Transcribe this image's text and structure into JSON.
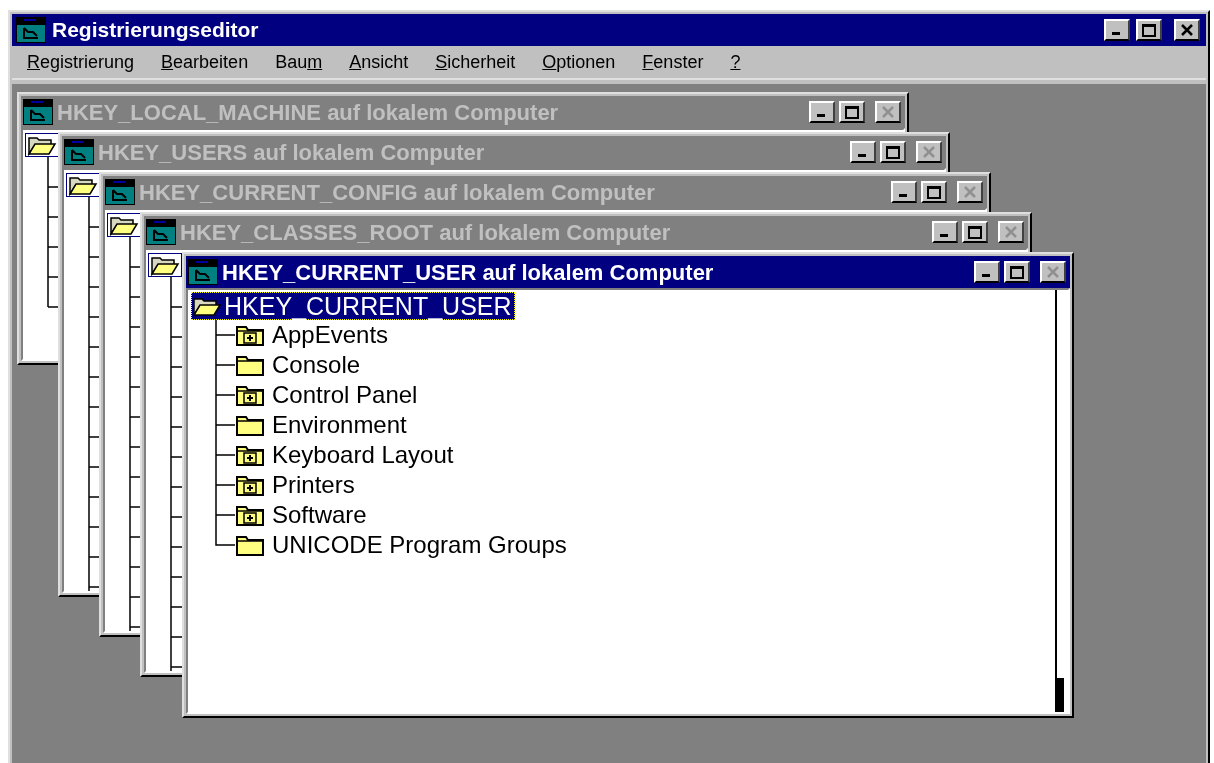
{
  "window": {
    "title": "Registrierungseditor"
  },
  "menu": [
    {
      "key": "R",
      "after": "egistrierung"
    },
    {
      "key": "B",
      "after": "earbeiten"
    },
    {
      "before": "Bau",
      "key": "m"
    },
    {
      "key": "A",
      "after": "nsicht"
    },
    {
      "key": "S",
      "after": "icherheit"
    },
    {
      "key": "O",
      "after": "ptionen"
    },
    {
      "key": "F",
      "after": "enster"
    },
    {
      "key": "?"
    }
  ],
  "child_windows": [
    {
      "title": "HKEY_LOCAL_MACHINE auf lokalem Computer",
      "active": false
    },
    {
      "title": "HKEY_USERS auf lokalem Computer",
      "active": false
    },
    {
      "title": "HKEY_CURRENT_CONFIG auf lokalem Computer",
      "active": false
    },
    {
      "title": "HKEY_CLASSES_ROOT auf lokalem Computer",
      "active": false
    },
    {
      "title": "HKEY_CURRENT_USER auf lokalem Computer",
      "active": true,
      "tree": {
        "label": "HKEY_CURRENT_USER",
        "selected": true,
        "children": [
          {
            "label": "AppEvents",
            "expandable": true,
            "selected": false
          },
          {
            "label": "Console",
            "expandable": false,
            "selected": false
          },
          {
            "label": "Control Panel",
            "expandable": true,
            "selected": false
          },
          {
            "label": "Environment",
            "expandable": false,
            "selected": false
          },
          {
            "label": "Keyboard Layout",
            "expandable": true,
            "selected": false
          },
          {
            "label": "Printers",
            "expandable": true,
            "selected": false
          },
          {
            "label": "Software",
            "expandable": true,
            "selected": false
          },
          {
            "label": "UNICODE Program Groups",
            "expandable": false,
            "selected": false
          }
        ]
      }
    }
  ]
}
